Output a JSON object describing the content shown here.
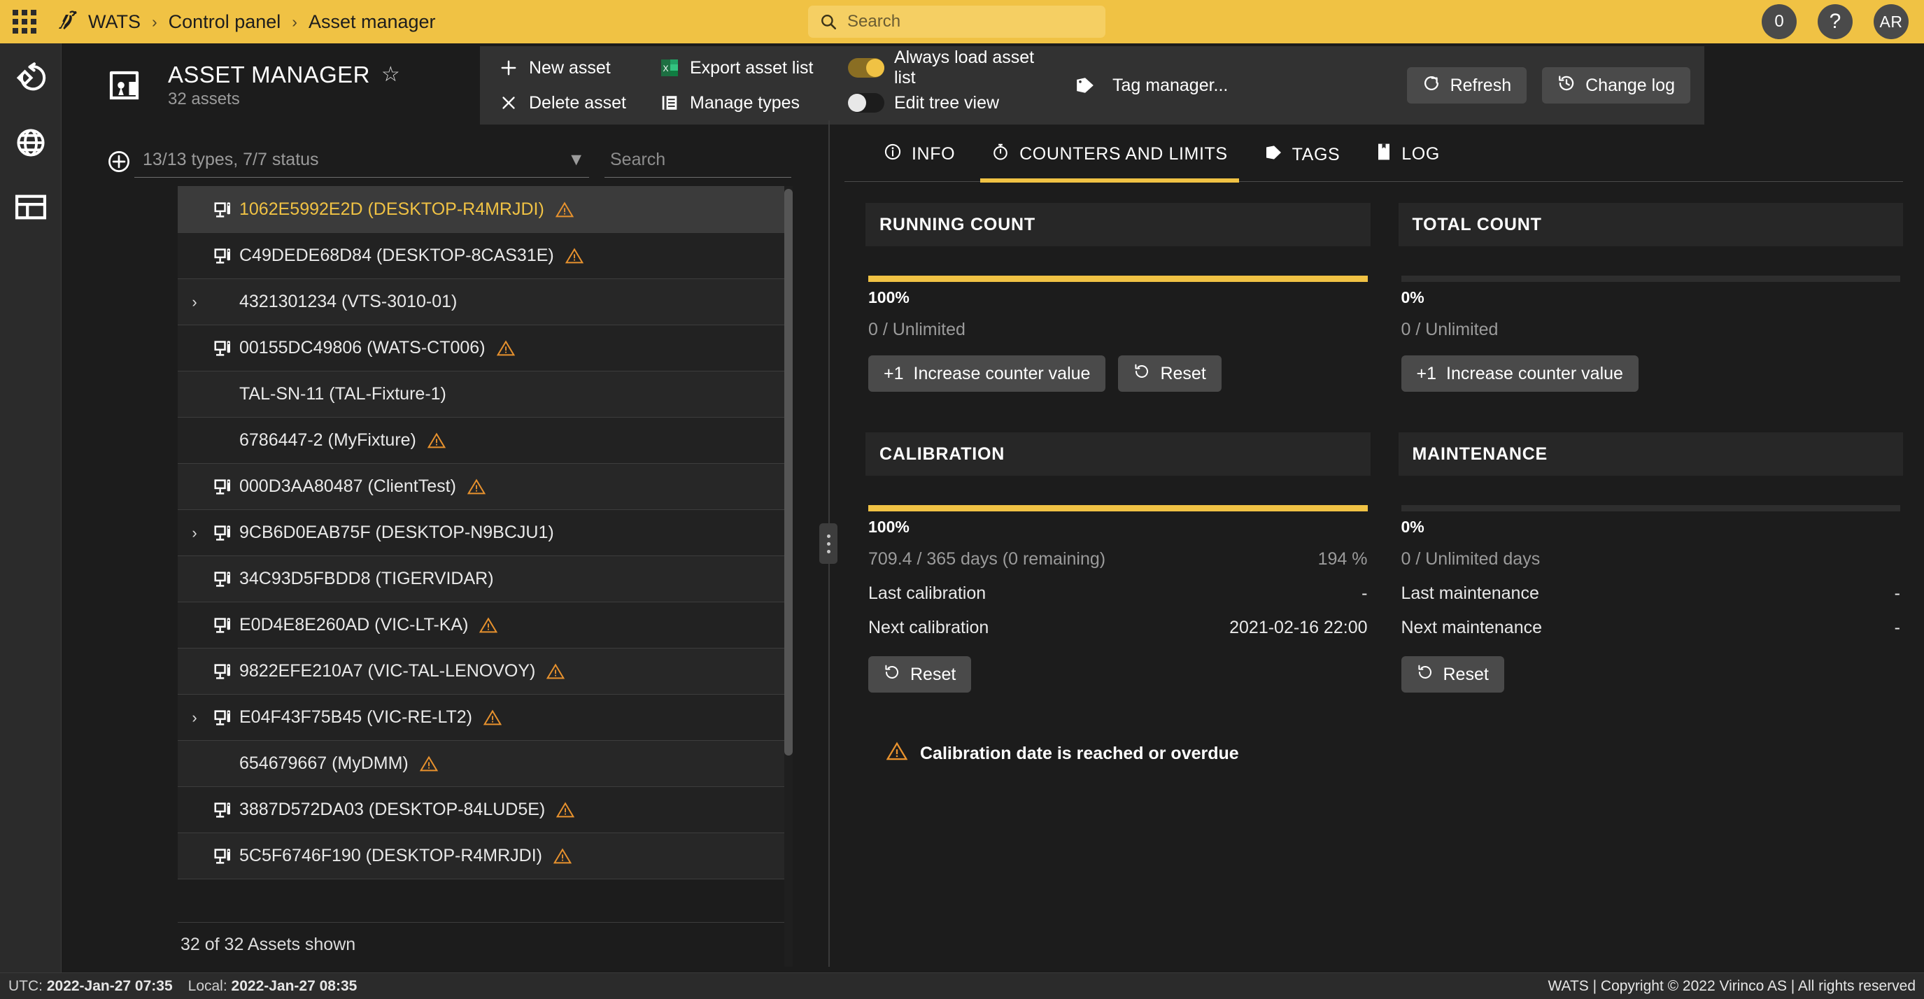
{
  "topbar": {
    "brand": "WATS",
    "breadcrumbs": [
      "WATS",
      "Control panel",
      "Asset manager"
    ],
    "separator": "›",
    "search": {
      "value": "",
      "placeholder": "Search"
    },
    "notifications_count": "0",
    "help_label": "?",
    "avatar_initials": "AR"
  },
  "page": {
    "title": "ASSET MANAGER",
    "subtitle": "32 assets",
    "actions": {
      "new_asset": "New asset",
      "delete_asset": "Delete asset",
      "export_asset_list": "Export asset list",
      "manage_types": "Manage types",
      "always_load_asset_list": "Always load asset list",
      "always_load_asset_list_state": "on",
      "edit_tree_view": "Edit tree view",
      "edit_tree_view_state": "off",
      "tag_manager": "Tag manager..."
    },
    "refresh": "Refresh",
    "change_log": "Change log"
  },
  "assetlist": {
    "type_filter": "13/13 types, 7/7 status",
    "search": {
      "value": "",
      "placeholder": "Search"
    },
    "footer": "32 of 32 Assets shown",
    "rows": [
      {
        "label": "1062E5992E2D (DESKTOP-R4MRJDI)",
        "icon": "computer",
        "expandable": false,
        "warn": true,
        "selected": true
      },
      {
        "label": "C49DEDE68D84 (DESKTOP-8CAS31E)",
        "icon": "computer",
        "expandable": false,
        "warn": true,
        "selected": false
      },
      {
        "label": "4321301234 (VTS-3010-01)",
        "icon": "none",
        "expandable": true,
        "warn": false,
        "selected": false
      },
      {
        "label": "00155DC49806 (WATS-CT006)",
        "icon": "computer",
        "expandable": false,
        "warn": true,
        "selected": false
      },
      {
        "label": "TAL-SN-11 (TAL-Fixture-1)",
        "icon": "none",
        "expandable": false,
        "warn": false,
        "selected": false
      },
      {
        "label": "6786447-2 (MyFixture)",
        "icon": "none",
        "expandable": false,
        "warn": true,
        "selected": false
      },
      {
        "label": "000D3AA80487 (ClientTest)",
        "icon": "computer",
        "expandable": false,
        "warn": true,
        "selected": false
      },
      {
        "label": "9CB6D0EAB75F (DESKTOP-N9BCJU1)",
        "icon": "computer",
        "expandable": true,
        "warn": false,
        "selected": false
      },
      {
        "label": "34C93D5FBDD8 (TIGERVIDAR)",
        "icon": "computer",
        "expandable": false,
        "warn": false,
        "selected": false
      },
      {
        "label": "E0D4E8E260AD (VIC-LT-KA)",
        "icon": "computer",
        "expandable": false,
        "warn": true,
        "selected": false
      },
      {
        "label": "9822EFE210A7 (VIC-TAL-LENOVOY)",
        "icon": "computer",
        "expandable": false,
        "warn": true,
        "selected": false
      },
      {
        "label": "E04F43F75B45 (VIC-RE-LT2)",
        "icon": "computer",
        "expandable": true,
        "warn": true,
        "selected": false
      },
      {
        "label": "654679667 (MyDMM)",
        "icon": "none",
        "expandable": false,
        "warn": true,
        "selected": false
      },
      {
        "label": "3887D572DA03 (DESKTOP-84LUD5E)",
        "icon": "computer",
        "expandable": false,
        "warn": true,
        "selected": false
      },
      {
        "label": "5C5F6746F190 (DESKTOP-R4MRJDI)",
        "icon": "computer",
        "expandable": false,
        "warn": true,
        "selected": false
      }
    ]
  },
  "detail": {
    "tabs": [
      {
        "label": "INFO",
        "icon": "info-icon",
        "active": false
      },
      {
        "label": "COUNTERS AND LIMITS",
        "icon": "timer-icon",
        "active": true
      },
      {
        "label": "TAGS",
        "icon": "tag-icon",
        "active": false
      },
      {
        "label": "LOG",
        "icon": "book-icon",
        "active": false
      }
    ],
    "running_count": {
      "title": "RUNNING COUNT",
      "percent_label": "100%",
      "percent_value": 100,
      "ratio": "0 / Unlimited",
      "ratio_right": "",
      "increase_label": "Increase counter value",
      "increase_prefix": "+1",
      "reset_label": "Reset"
    },
    "total_count": {
      "title": "TOTAL COUNT",
      "percent_label": "0%",
      "percent_value": 0,
      "ratio": "0 / Unlimited",
      "ratio_right": "",
      "increase_label": "Increase counter value",
      "increase_prefix": "+1"
    },
    "calibration": {
      "title": "CALIBRATION",
      "percent_label": "100%",
      "percent_value": 100,
      "ratio": "709.4 / 365 days (0 remaining)",
      "ratio_right": "194 %",
      "last_label": "Last calibration",
      "last_value": "-",
      "next_label": "Next calibration",
      "next_value": "2021-02-16 22:00",
      "reset_label": "Reset"
    },
    "maintenance": {
      "title": "MAINTENANCE",
      "percent_label": "0%",
      "percent_value": 0,
      "ratio": "0 / Unlimited days",
      "ratio_right": "",
      "last_label": "Last maintenance",
      "last_value": "-",
      "next_label": "Next maintenance",
      "next_value": "-",
      "reset_label": "Reset"
    },
    "warning": "Calibration date is reached or overdue"
  },
  "footer": {
    "utc_label": "UTC:",
    "utc_value": "2022-Jan-27 07:35",
    "local_label": "Local:",
    "local_value": "2022-Jan-27 08:35",
    "copyright": "WATS | Copyright © 2022 Virinco AS | All rights reserved"
  },
  "colors": {
    "accent": "#f0c244",
    "warning": "#e8922e",
    "panel": "#272727",
    "background": "#1c1c1c"
  }
}
